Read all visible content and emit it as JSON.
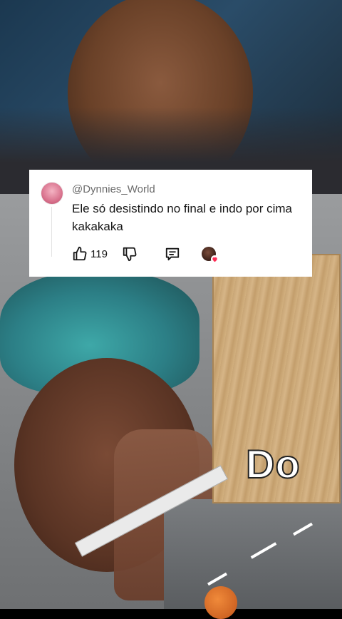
{
  "comment": {
    "username": "@Dynnies_World",
    "text": "Ele só desistindo no final e indo por cima kakakaka",
    "like_count": "119"
  },
  "board": {
    "text": "Do"
  },
  "icons": [
    "like-icon",
    "dislike-icon",
    "reply-icon",
    "creator-liked-avatar",
    "heart-icon"
  ],
  "colors": {
    "card_bg": "#ffffff",
    "text": "#161616",
    "muted": "#6b6b6b",
    "heart": "#fe2c55"
  }
}
